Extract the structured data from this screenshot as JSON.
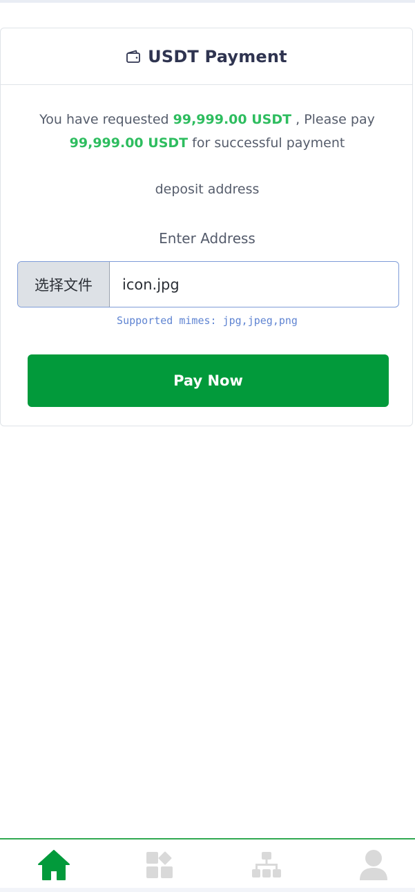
{
  "header": {
    "title": "USDT Payment",
    "icon": "wallet-icon"
  },
  "request": {
    "prefix": "You have requested",
    "amount_1": "99,999.00 USDT",
    "middle": ", Please pay",
    "amount_2": "99,999.00 USDT",
    "suffix": "for successful payment"
  },
  "deposit_label": "deposit address",
  "address": {
    "label": "Enter Address",
    "choose_file_label": "选择文件",
    "file_name": "icon.jpg",
    "supported_text": "Supported mimes: jpg,jpeg,png"
  },
  "pay_button": {
    "label": "Pay Now"
  },
  "colors": {
    "accent_green": "#029a3b",
    "highlight_green": "#2ebd5f",
    "inactive_icon": "#d9d9d9"
  },
  "bottom_nav": {
    "items": [
      {
        "icon": "home-icon",
        "active": true
      },
      {
        "icon": "apps-icon",
        "active": false
      },
      {
        "icon": "network-icon",
        "active": false
      },
      {
        "icon": "user-icon",
        "active": false
      }
    ]
  }
}
